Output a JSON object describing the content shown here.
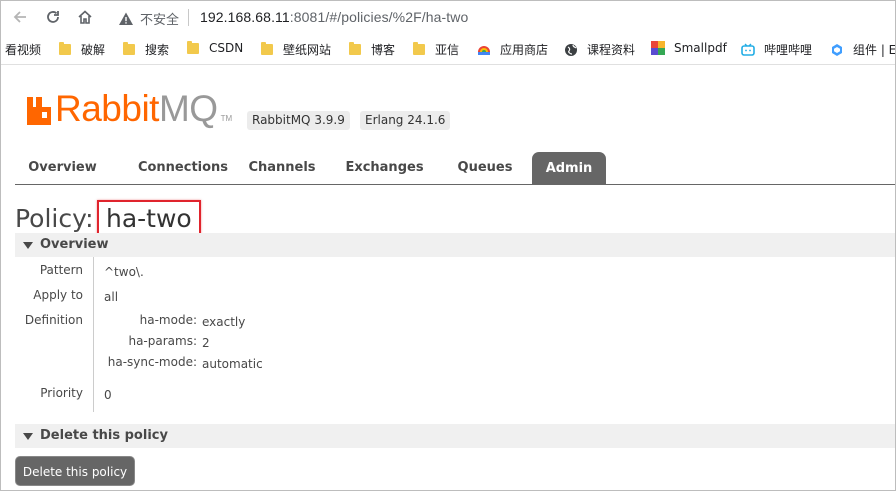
{
  "browser": {
    "security_label": "不安全",
    "url_host": "192.168.68.11",
    "url_rest": ":8081/#/policies/%2F/ha-two",
    "bookmarks": [
      {
        "label": "看视频",
        "icon": "none"
      },
      {
        "label": "破解",
        "icon": "folder-icon"
      },
      {
        "label": "搜索",
        "icon": "folder-icon"
      },
      {
        "label": "CSDN",
        "icon": "folder-icon"
      },
      {
        "label": "壁纸网站",
        "icon": "folder-icon"
      },
      {
        "label": "博客",
        "icon": "folder-icon"
      },
      {
        "label": "亚信",
        "icon": "folder-icon"
      },
      {
        "label": "应用商店",
        "icon": "app-store-icon"
      },
      {
        "label": "课程资料",
        "icon": "globe-icon"
      },
      {
        "label": "Smallpdf",
        "icon": "smallpdf-icon"
      },
      {
        "label": "哔哩哔哩",
        "icon": "bilibili-icon"
      },
      {
        "label": "组件 | E",
        "icon": "element-icon"
      }
    ]
  },
  "header": {
    "logo_rabbit": "Rabbit",
    "logo_mq": "MQ",
    "logo_tm": "TM",
    "rabbitmq_version": "RabbitMQ 3.9.9",
    "erlang_version": "Erlang 24.1.6",
    "accent": "#ff6600"
  },
  "tabs": [
    {
      "label": "Overview",
      "active": false
    },
    {
      "label": "Connections",
      "active": false
    },
    {
      "label": "Channels",
      "active": false
    },
    {
      "label": "Exchanges",
      "active": false
    },
    {
      "label": "Queues",
      "active": false
    },
    {
      "label": "Admin",
      "active": true
    }
  ],
  "policy": {
    "heading_prefix": "Policy:",
    "name": "ha-two",
    "overview_title": "Overview",
    "fields": {
      "pattern_label": "Pattern",
      "pattern_value": "^two\\.",
      "apply_to_label": "Apply to",
      "apply_to_value": "all",
      "definition_label": "Definition",
      "definition": [
        {
          "key": "ha-mode:",
          "value": "exactly"
        },
        {
          "key": "ha-params:",
          "value": "2"
        },
        {
          "key": "ha-sync-mode:",
          "value": "automatic"
        }
      ],
      "priority_label": "Priority",
      "priority_value": "0"
    },
    "delete_section_title": "Delete this policy",
    "delete_button": "Delete this policy"
  }
}
